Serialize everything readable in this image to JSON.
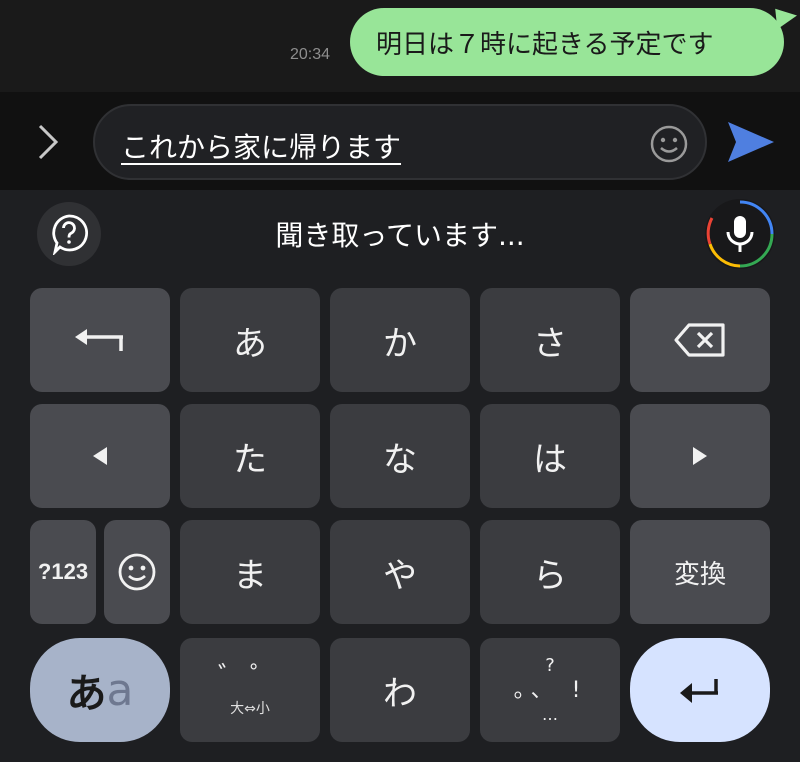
{
  "chat": {
    "timestamp": "20:34",
    "message": "明日は７時に起きる予定です"
  },
  "composer": {
    "text": "これから家に帰ります"
  },
  "voice": {
    "status": "聞き取っています..."
  },
  "keyboard": {
    "row1": [
      "あ",
      "か",
      "さ"
    ],
    "row2": [
      "た",
      "な",
      "は"
    ],
    "row3": [
      "ま",
      "や",
      "ら"
    ],
    "symbols_label": "?123",
    "convert_label": "変換",
    "wa_label": "わ",
    "mode_primary": "あ",
    "mode_secondary": "a",
    "dakuten_top": "゛゜",
    "dakuten_bottom": "大⇔小",
    "punct_top": "?",
    "punct_mid": "。、 !",
    "punct_bottom": "…"
  },
  "colors": {
    "bubble": "#98e598",
    "send": "#4f7fe0",
    "enter_key": "#d6e3ff",
    "mode_key": "#a7b3c9"
  },
  "icons": {
    "expand": "chevron-right-icon",
    "emoji": "smiley-icon",
    "send": "send-icon",
    "help": "help-bubble-icon",
    "mic": "mic-icon",
    "undo": "undo-icon",
    "backspace": "backspace-icon",
    "left": "arrow-left-icon",
    "right": "arrow-right-icon",
    "enter": "enter-icon"
  }
}
